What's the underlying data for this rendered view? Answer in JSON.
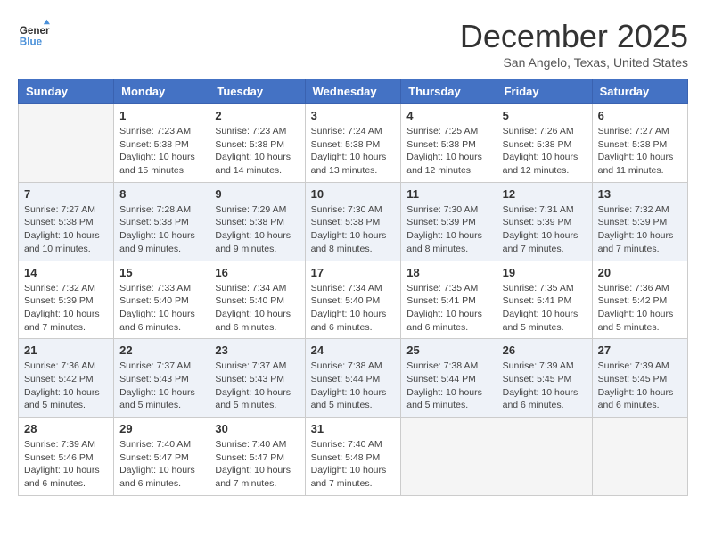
{
  "logo": {
    "line1": "General",
    "line2": "Blue"
  },
  "title": "December 2025",
  "location": "San Angelo, Texas, United States",
  "weekdays": [
    "Sunday",
    "Monday",
    "Tuesday",
    "Wednesday",
    "Thursday",
    "Friday",
    "Saturday"
  ],
  "weeks": [
    [
      {
        "day": "",
        "info": ""
      },
      {
        "day": "1",
        "info": "Sunrise: 7:23 AM\nSunset: 5:38 PM\nDaylight: 10 hours\nand 15 minutes."
      },
      {
        "day": "2",
        "info": "Sunrise: 7:23 AM\nSunset: 5:38 PM\nDaylight: 10 hours\nand 14 minutes."
      },
      {
        "day": "3",
        "info": "Sunrise: 7:24 AM\nSunset: 5:38 PM\nDaylight: 10 hours\nand 13 minutes."
      },
      {
        "day": "4",
        "info": "Sunrise: 7:25 AM\nSunset: 5:38 PM\nDaylight: 10 hours\nand 12 minutes."
      },
      {
        "day": "5",
        "info": "Sunrise: 7:26 AM\nSunset: 5:38 PM\nDaylight: 10 hours\nand 12 minutes."
      },
      {
        "day": "6",
        "info": "Sunrise: 7:27 AM\nSunset: 5:38 PM\nDaylight: 10 hours\nand 11 minutes."
      }
    ],
    [
      {
        "day": "7",
        "info": "Sunrise: 7:27 AM\nSunset: 5:38 PM\nDaylight: 10 hours\nand 10 minutes."
      },
      {
        "day": "8",
        "info": "Sunrise: 7:28 AM\nSunset: 5:38 PM\nDaylight: 10 hours\nand 9 minutes."
      },
      {
        "day": "9",
        "info": "Sunrise: 7:29 AM\nSunset: 5:38 PM\nDaylight: 10 hours\nand 9 minutes."
      },
      {
        "day": "10",
        "info": "Sunrise: 7:30 AM\nSunset: 5:38 PM\nDaylight: 10 hours\nand 8 minutes."
      },
      {
        "day": "11",
        "info": "Sunrise: 7:30 AM\nSunset: 5:39 PM\nDaylight: 10 hours\nand 8 minutes."
      },
      {
        "day": "12",
        "info": "Sunrise: 7:31 AM\nSunset: 5:39 PM\nDaylight: 10 hours\nand 7 minutes."
      },
      {
        "day": "13",
        "info": "Sunrise: 7:32 AM\nSunset: 5:39 PM\nDaylight: 10 hours\nand 7 minutes."
      }
    ],
    [
      {
        "day": "14",
        "info": "Sunrise: 7:32 AM\nSunset: 5:39 PM\nDaylight: 10 hours\nand 7 minutes."
      },
      {
        "day": "15",
        "info": "Sunrise: 7:33 AM\nSunset: 5:40 PM\nDaylight: 10 hours\nand 6 minutes."
      },
      {
        "day": "16",
        "info": "Sunrise: 7:34 AM\nSunset: 5:40 PM\nDaylight: 10 hours\nand 6 minutes."
      },
      {
        "day": "17",
        "info": "Sunrise: 7:34 AM\nSunset: 5:40 PM\nDaylight: 10 hours\nand 6 minutes."
      },
      {
        "day": "18",
        "info": "Sunrise: 7:35 AM\nSunset: 5:41 PM\nDaylight: 10 hours\nand 6 minutes."
      },
      {
        "day": "19",
        "info": "Sunrise: 7:35 AM\nSunset: 5:41 PM\nDaylight: 10 hours\nand 5 minutes."
      },
      {
        "day": "20",
        "info": "Sunrise: 7:36 AM\nSunset: 5:42 PM\nDaylight: 10 hours\nand 5 minutes."
      }
    ],
    [
      {
        "day": "21",
        "info": "Sunrise: 7:36 AM\nSunset: 5:42 PM\nDaylight: 10 hours\nand 5 minutes."
      },
      {
        "day": "22",
        "info": "Sunrise: 7:37 AM\nSunset: 5:43 PM\nDaylight: 10 hours\nand 5 minutes."
      },
      {
        "day": "23",
        "info": "Sunrise: 7:37 AM\nSunset: 5:43 PM\nDaylight: 10 hours\nand 5 minutes."
      },
      {
        "day": "24",
        "info": "Sunrise: 7:38 AM\nSunset: 5:44 PM\nDaylight: 10 hours\nand 5 minutes."
      },
      {
        "day": "25",
        "info": "Sunrise: 7:38 AM\nSunset: 5:44 PM\nDaylight: 10 hours\nand 5 minutes."
      },
      {
        "day": "26",
        "info": "Sunrise: 7:39 AM\nSunset: 5:45 PM\nDaylight: 10 hours\nand 6 minutes."
      },
      {
        "day": "27",
        "info": "Sunrise: 7:39 AM\nSunset: 5:45 PM\nDaylight: 10 hours\nand 6 minutes."
      }
    ],
    [
      {
        "day": "28",
        "info": "Sunrise: 7:39 AM\nSunset: 5:46 PM\nDaylight: 10 hours\nand 6 minutes."
      },
      {
        "day": "29",
        "info": "Sunrise: 7:40 AM\nSunset: 5:47 PM\nDaylight: 10 hours\nand 6 minutes."
      },
      {
        "day": "30",
        "info": "Sunrise: 7:40 AM\nSunset: 5:47 PM\nDaylight: 10 hours\nand 7 minutes."
      },
      {
        "day": "31",
        "info": "Sunrise: 7:40 AM\nSunset: 5:48 PM\nDaylight: 10 hours\nand 7 minutes."
      },
      {
        "day": "",
        "info": ""
      },
      {
        "day": "",
        "info": ""
      },
      {
        "day": "",
        "info": ""
      }
    ]
  ]
}
